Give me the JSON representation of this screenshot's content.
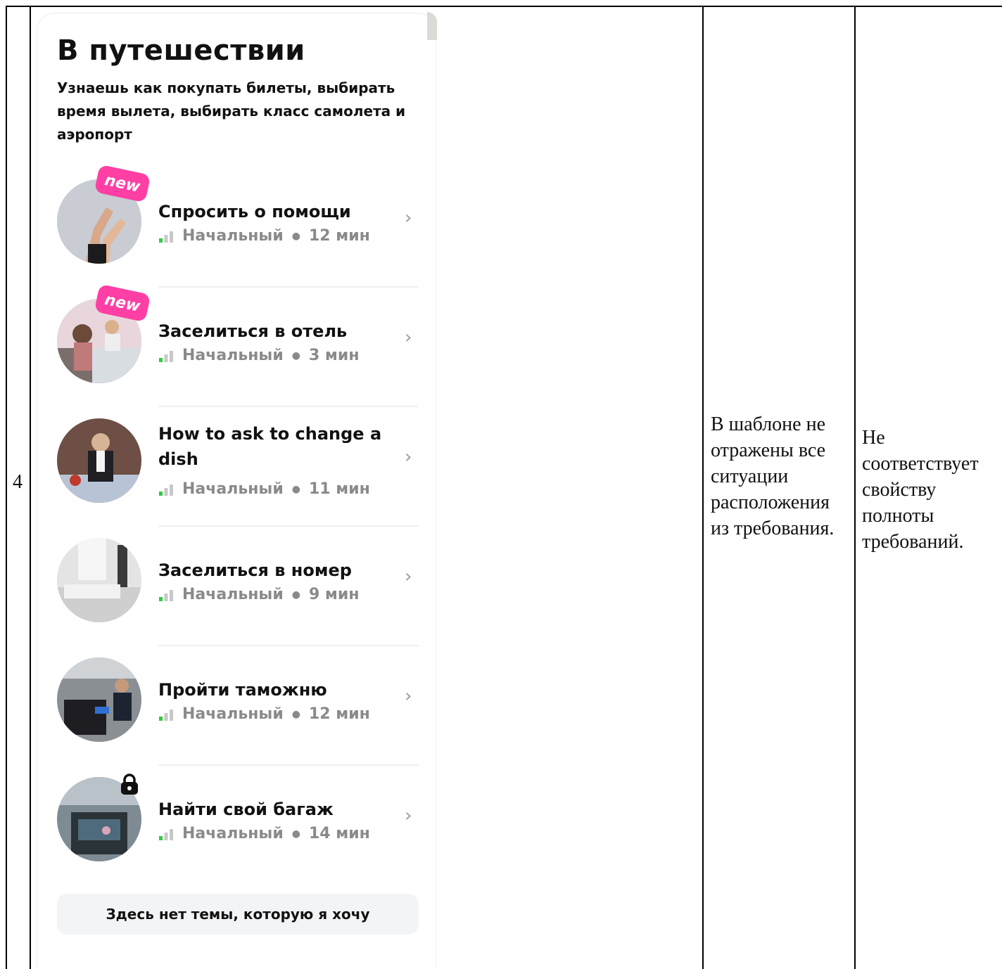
{
  "row_number": "4",
  "screen": {
    "title": "В путешествии",
    "subtitle": "Узнаешь как покупать билеты, выбирать время вылета, выбирать класс самолета и аэропорт",
    "lessons": [
      {
        "title": "Спросить о помощи",
        "level": "Начальный",
        "duration": "12 мин",
        "badge": "new",
        "locked": false,
        "image": "hands-photo"
      },
      {
        "title": "Заселиться в отель",
        "level": "Начальный",
        "duration": "3 мин",
        "badge": "new",
        "locked": false,
        "image": "hotel-reception-photo"
      },
      {
        "title": "How to ask to change a dish",
        "level": "Начальный",
        "duration": "11 мин",
        "badge": "",
        "locked": false,
        "image": "waiter-photo"
      },
      {
        "title": "Заселиться в номер",
        "level": "Начальный",
        "duration": "9 мин",
        "badge": "",
        "locked": false,
        "image": "hotel-room-photo"
      },
      {
        "title": "Пройти таможню",
        "level": "Начальный",
        "duration": "12 мин",
        "badge": "",
        "locked": false,
        "image": "customs-photo"
      },
      {
        "title": "Найти свой багаж",
        "level": "Начальный",
        "duration": "14 мин",
        "badge": "",
        "locked": true,
        "image": "baggage-photo"
      }
    ],
    "bottom_button": "Здесь нет темы, которую я хочу"
  },
  "comment": "В шаблоне не отражены все ситуации расположения из требования.",
  "verdict": "Не соответствует свойству полноты требований.",
  "colors": {
    "badge": "#ff3fa4",
    "level_active": "#2ecc40",
    "level_inactive": "#c8c8c8",
    "meta_text": "#8a8a8a",
    "button_bg": "#f3f4f6"
  }
}
